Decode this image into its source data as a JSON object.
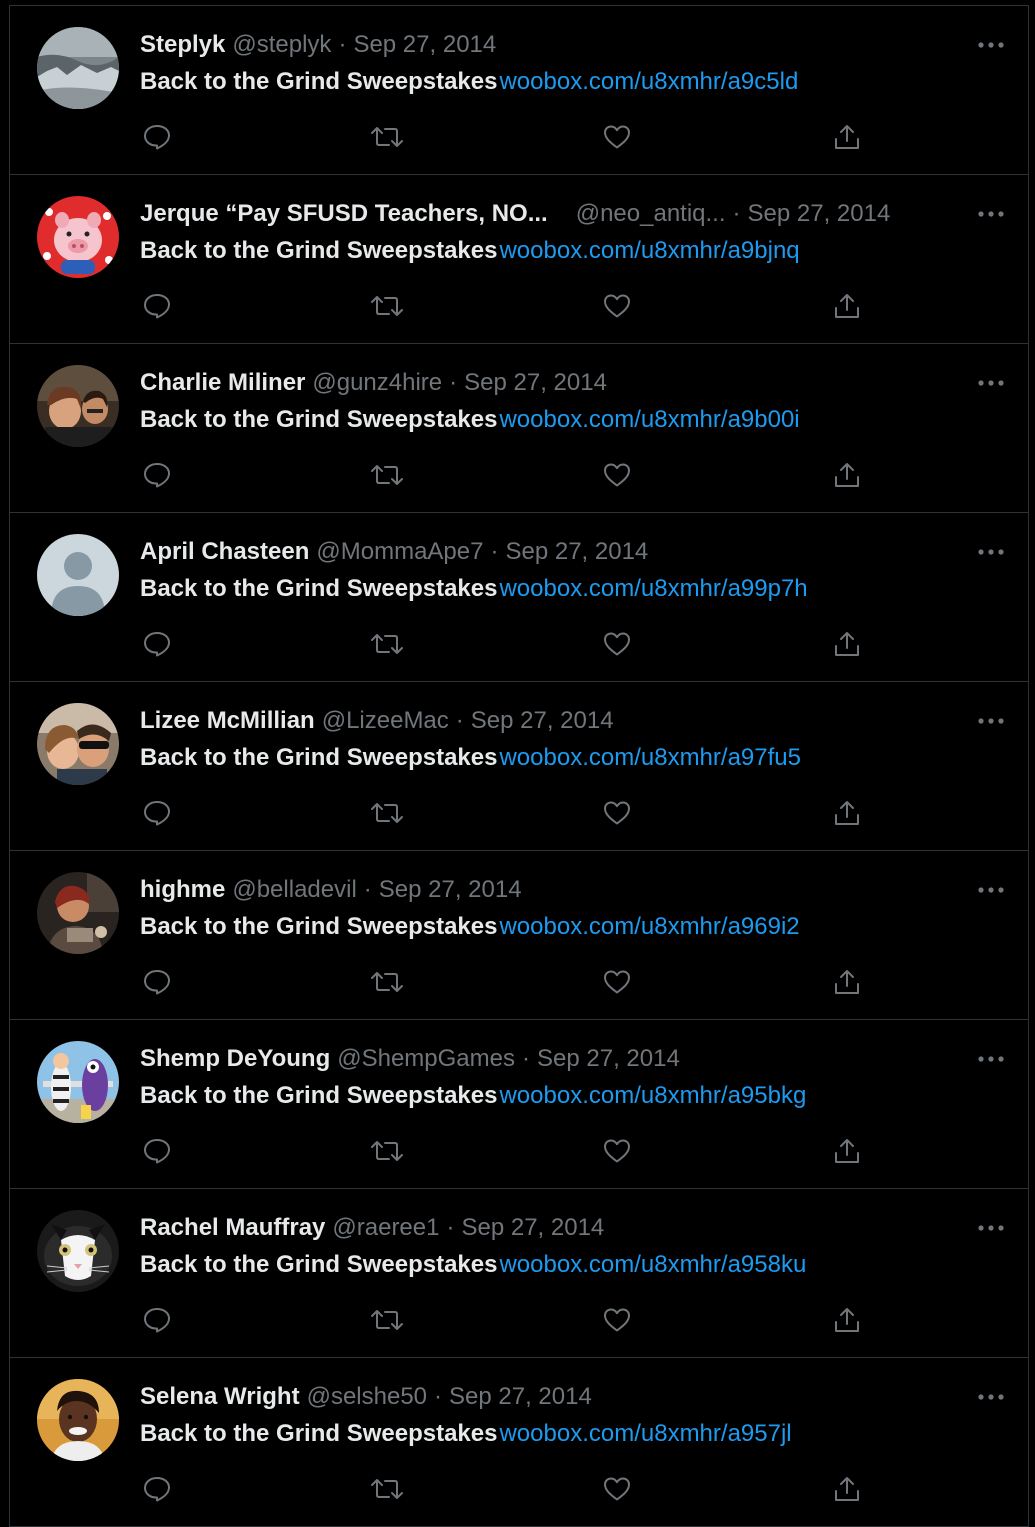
{
  "colors": {
    "background": "#000000",
    "divider": "#2f3336",
    "primary_text": "#e7e9ea",
    "secondary_text": "#71767b",
    "link": "#1d9bf0"
  },
  "icons": {
    "reply": "reply-icon",
    "retweet": "retweet-icon",
    "like": "like-icon",
    "share": "share-icon",
    "more": "more-options-icon"
  },
  "tweets": [
    {
      "name": "Steplyk",
      "handle": "@steplyk",
      "separator": "·",
      "date": "Sep 27, 2014",
      "text": "Back to the Grind Sweepstakes",
      "link": "woobox.com/u8xmhr/a9c5ld"
    },
    {
      "name": "Jerque “Pay SFUSD Teachers, NO...",
      "handle": "@neo_antiq...",
      "separator": "·",
      "date": "Sep 27, 2014",
      "text": "Back to the Grind Sweepstakes",
      "link": "woobox.com/u8xmhr/a9bjnq"
    },
    {
      "name": "Charlie Miliner",
      "handle": "@gunz4hire",
      "separator": "·",
      "date": "Sep 27, 2014",
      "text": "Back to the Grind Sweepstakes",
      "link": "woobox.com/u8xmhr/a9b00i"
    },
    {
      "name": "April Chasteen",
      "handle": "@MommaApe7",
      "separator": "·",
      "date": "Sep 27, 2014",
      "text": "Back to the Grind Sweepstakes",
      "link": "woobox.com/u8xmhr/a99p7h"
    },
    {
      "name": "Lizee McMillian",
      "handle": "@LizeeMac",
      "separator": "·",
      "date": "Sep 27, 2014",
      "text": "Back to the Grind Sweepstakes",
      "link": "woobox.com/u8xmhr/a97fu5"
    },
    {
      "name": "highme",
      "handle": "@belladevil",
      "separator": "·",
      "date": "Sep 27, 2014",
      "text": "Back to the Grind Sweepstakes",
      "link": "woobox.com/u8xmhr/a969i2"
    },
    {
      "name": "Shemp DeYoung",
      "handle": "@ShempGames",
      "separator": "·",
      "date": "Sep 27, 2014",
      "text": "Back to the Grind Sweepstakes",
      "link": "woobox.com/u8xmhr/a95bkg"
    },
    {
      "name": "Rachel Mauffray",
      "handle": "@raeree1",
      "separator": "·",
      "date": "Sep 27, 2014",
      "text": "Back to the Grind Sweepstakes",
      "link": "woobox.com/u8xmhr/a958ku"
    },
    {
      "name": "Selena Wright",
      "handle": "@selshe50",
      "separator": "·",
      "date": "Sep 27, 2014",
      "text": "Back to the Grind Sweepstakes",
      "link": "woobox.com/u8xmhr/a957jl"
    }
  ]
}
